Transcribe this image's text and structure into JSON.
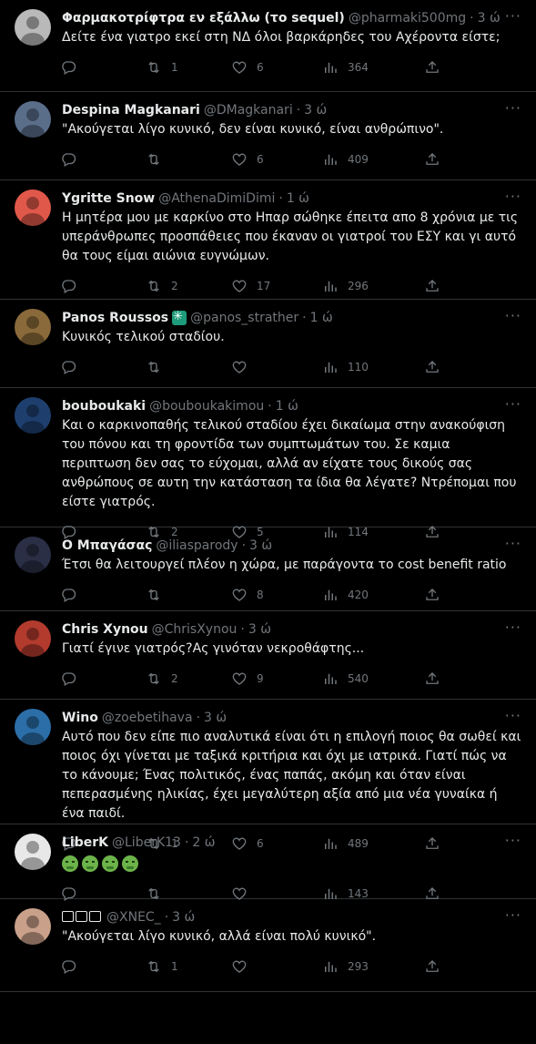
{
  "tweets": [
    {
      "name": "Φαρμακοτρίφτρα εν εξάλλω (το sequel)",
      "handle": "@pharmaki500mg",
      "time": "3 ώ",
      "text": "Δείτε ένα γιατρο εκεί στη ΝΔ όλοι βαρκάρηδες του Αχέροντα είστε;",
      "replies": "",
      "retweets": "1",
      "likes": "6",
      "views": "364",
      "avatar_color": "#b9b9b9"
    },
    {
      "name": "Despina Magkanari",
      "handle": "@DMagkanari",
      "time": "3 ώ",
      "text": "\"Ακούγεται λίγο κυνικό, δεν είναι κυνικό, είναι ανθρώπινο\".",
      "replies": "",
      "retweets": "",
      "likes": "6",
      "views": "409",
      "avatar_color": "#5a6e8a"
    },
    {
      "name": "Ygritte Snow",
      "handle": "@AthenaDimiDimi",
      "time": "1 ώ",
      "text": "Η μητέρα μου με καρκίνο στο Ηπαρ σώθηκε έπειτα απο 8 χρόνια με τις υπεράνθρωπες προσπάθειες που έκαναν οι γιατροί του ΕΣΥ και γι αυτό θα τους είμαι αιώνια ευγνώμων.",
      "replies": "",
      "retweets": "2",
      "likes": "17",
      "views": "296",
      "avatar_color": "#e0584a"
    },
    {
      "name": "Panos Roussos",
      "handle": "@panos_strather",
      "time": "1 ώ",
      "text": "Κυνικός τελικού σταδίου.",
      "replies": "",
      "retweets": "",
      "likes": "",
      "views": "110",
      "avatar_color": "#8a6a3a"
    },
    {
      "name": "bouboukaki",
      "handle": "@bouboukakimou",
      "time": "1 ώ",
      "text": "Και ο καρκινοπαθής τελικού σταδίου έχει δικαίωμα στην ανακούφιση του πόνου και τη φροντίδα των συμπτωμάτων του. Σε καμια περιπτωση δεν σας το εύχομαι, αλλά αν είχατε τους δικούς σας ανθρώπους σε αυτη την κατάσταση τα ίδια θα λέγατε? Ντρέπομαι που είστε γιατρός.",
      "replies": "",
      "retweets": "2",
      "likes": "5",
      "views": "114",
      "avatar_color": "#1e3f6e"
    },
    {
      "name": "Ο Μπαγάσας",
      "handle": "@iliasparody",
      "time": "3 ώ",
      "text": "Έτσι θα λειτουργεί πλέον η χώρα, με παράγοντα το cost benefit ratio",
      "replies": "",
      "retweets": "",
      "likes": "8",
      "views": "420",
      "avatar_color": "#2a2f45"
    },
    {
      "name": "Chris Xynou",
      "handle": "@ChrisXynou",
      "time": "3 ώ",
      "text": "Γιατί έγινε γιατρός?Ας γινόταν νεκροθάφτης...",
      "replies": "",
      "retweets": "2",
      "likes": "9",
      "views": "540",
      "avatar_color": "#b23b2e"
    },
    {
      "name": "Wino",
      "handle": "@zoebetihava",
      "time": "3 ώ",
      "text": "Αυτό που δεν είπε πιο αναλυτικά είναι ότι η επιλογή ποιος θα σωθεί και ποιος όχι γίνεται με ταξικά κριτήρια και όχι με ιατρικά. Γιατί πώς να το κάνουμε; Ένας πολιτικός, ένας παπάς, ακόμη και όταν είναι πεπερασμένης ηλικίας, έχει μεγαλύτερη αξία από μια νέα γυναίκα ή ένα παιδί.",
      "replies": "",
      "retweets": "1",
      "likes": "6",
      "views": "489",
      "avatar_color": "#2b6ea8"
    },
    {
      "name": "LiberK",
      "handle": "@LiberK13",
      "time": "2 ώ",
      "text": "",
      "replies": "",
      "retweets": "",
      "likes": "",
      "views": "143",
      "avatar_color": "#e8e8e8"
    },
    {
      "name": "",
      "handle": "@XNEC_",
      "time": "3 ώ",
      "text": "\"Ακούγεται λίγο κυνικό, αλλά είναι πολύ κυνικό\".",
      "replies": "",
      "retweets": "1",
      "likes": "",
      "views": "293",
      "avatar_color": "#c9a08a"
    }
  ],
  "icons": {
    "reply": "reply-icon",
    "retweet": "retweet-icon",
    "like": "heart-icon",
    "views": "views-icon",
    "share": "share-icon",
    "more": "more-icon"
  }
}
